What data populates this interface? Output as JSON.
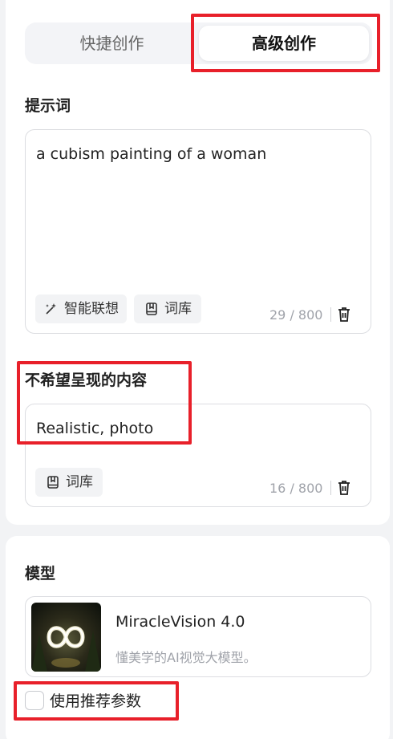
{
  "mode_tabs": {
    "quick": "快捷创作",
    "advanced": "高级创作",
    "active": "advanced"
  },
  "prompt": {
    "title": "提示词",
    "value": "a  cubism painting of a woman",
    "smart_label": "智能联想",
    "library_label": "词库",
    "counter": "29 / 800"
  },
  "negative": {
    "title": "不希望呈现的内容",
    "value": "Realistic, photo",
    "library_label": "词库",
    "counter": "16 / 800"
  },
  "model": {
    "title": "模型",
    "name": "MiracleVision 4.0",
    "description": "懂美学的AI视觉大模型。"
  },
  "recommend": {
    "label": "使用推荐参数",
    "checked": false
  },
  "icons": [
    "magic-wand-icon",
    "book-icon",
    "trash-icon",
    "checkbox-icon"
  ],
  "colors": {
    "highlight": "#e8202a",
    "muted": "#a0a3aa",
    "background": "#f2f3f5"
  }
}
